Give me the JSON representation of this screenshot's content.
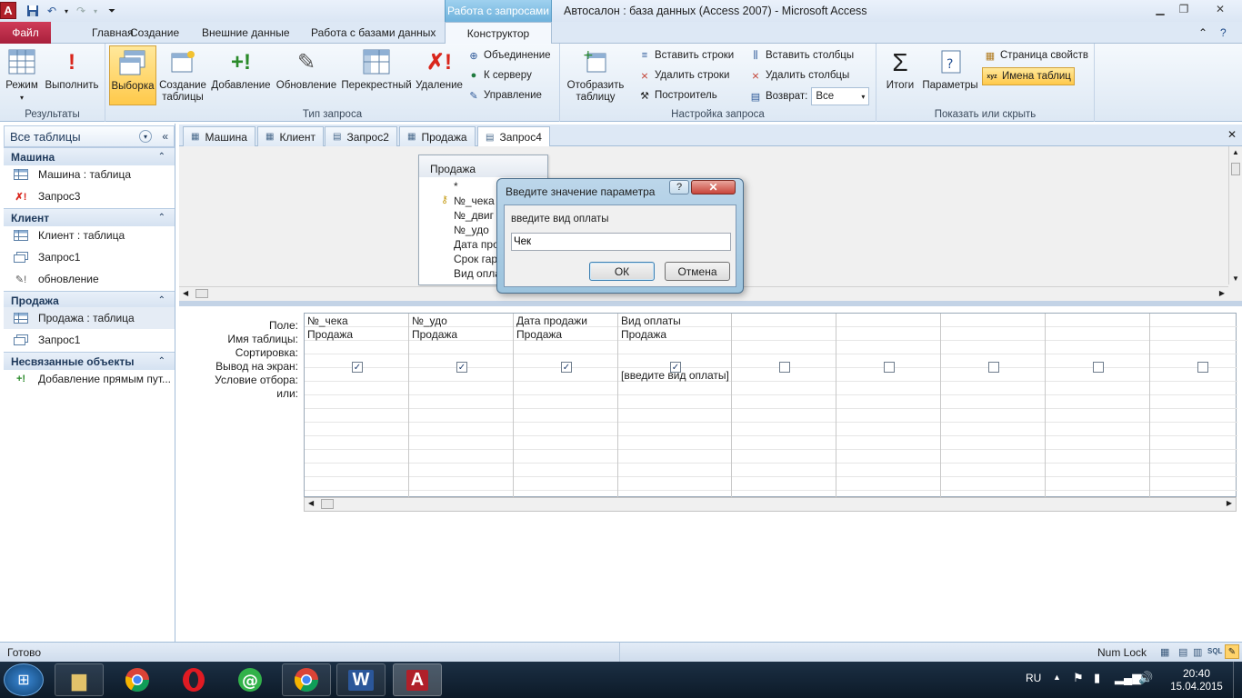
{
  "window": {
    "title": "Автосалон : база данных (Access 2007)  -  Microsoft Access",
    "context_tab": "Работа с запросами",
    "logo_letter": "A"
  },
  "ribbon_tabs": [
    "Файл",
    "Главная",
    "Создание",
    "Внешние данные",
    "Работа с базами данных",
    "Конструктор"
  ],
  "ribbon": {
    "results": {
      "label": "Результаты",
      "mode": "Режим",
      "run": "Выполнить"
    },
    "query_type": {
      "label": "Тип запроса",
      "select": "Выборка",
      "make_table_1": "Создание",
      "make_table_2": "таблицы",
      "append": "Добавление",
      "update": "Обновление",
      "crosstab": "Перекрестный",
      "delete": "Удаление",
      "union": "Объединение",
      "pass_through": "К серверу",
      "data_definition": "Управление"
    },
    "query_setup": {
      "label": "Настройка запроса",
      "show_table_1": "Отобразить",
      "show_table_2": "таблицу",
      "insert_rows": "Вставить строки",
      "delete_rows": "Удалить строки",
      "builder": "Построитель",
      "insert_cols": "Вставить столбцы",
      "delete_cols": "Удалить столбцы",
      "return_label": "Возврат:",
      "return_value": "Все"
    },
    "show_hide": {
      "label": "Показать или скрыть",
      "totals": "Итоги",
      "parameters": "Параметры",
      "property_sheet": "Страница свойств",
      "table_names": "Имена таблиц"
    }
  },
  "nav": {
    "header": "Все таблицы",
    "groups": [
      {
        "name": "Машина",
        "items": [
          "Машина : таблица",
          "Запрос3"
        ]
      },
      {
        "name": "Клиент",
        "items": [
          "Клиент : таблица",
          "Запрос1",
          "обновление"
        ]
      },
      {
        "name": "Продажа",
        "items": [
          "Продажа : таблица",
          "Запрос1"
        ]
      },
      {
        "name": "Несвязанные объекты",
        "items": [
          "Добавление прямым пут..."
        ]
      }
    ]
  },
  "doc_tabs": [
    "Машина",
    "Клиент",
    "Запрос2",
    "Продажа",
    "Запрос4"
  ],
  "table_box": {
    "title": "Продажа",
    "fields": [
      "*",
      "№_чека",
      "№_двиг",
      "№_удо",
      "Дата про",
      "Срок гар",
      "Вид опла"
    ]
  },
  "grid": {
    "row_labels": [
      "Поле:",
      "Имя таблицы:",
      "Сортировка:",
      "Вывод на экран:",
      "Условие отбора:",
      "или:"
    ],
    "columns": [
      {
        "field": "№_чека",
        "table": "Продажа",
        "criteria": ""
      },
      {
        "field": "№_удо",
        "table": "Продажа",
        "criteria": ""
      },
      {
        "field": "Дата продажи",
        "table": "Продажа",
        "criteria": ""
      },
      {
        "field": "Вид оплаты",
        "table": "Продажа",
        "criteria": "[введите вид оплаты]"
      }
    ]
  },
  "dialog": {
    "title": "Введите значение параметра",
    "prompt": "введите вид оплаты",
    "input_value": "Чек",
    "ok": "ОК",
    "cancel": "Отмена",
    "help": "?",
    "close": "✕"
  },
  "status": {
    "text": "Готово",
    "numlock": "Num Lock"
  },
  "taskbar": {
    "lang": "RU",
    "time": "20:40",
    "date": "15.04.2015"
  }
}
